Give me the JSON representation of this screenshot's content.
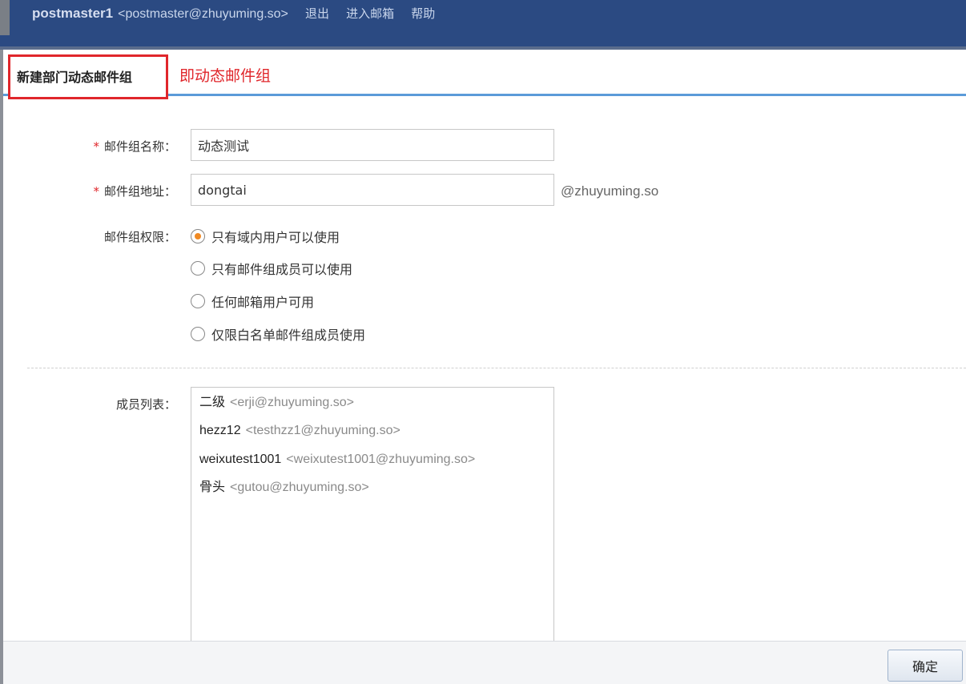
{
  "header": {
    "username": "postmaster1",
    "email": "<postmaster@zhuyuming.so>",
    "links": [
      "退出",
      "进入邮箱",
      "帮助"
    ]
  },
  "tabs": {
    "active_label": "新建部门动态邮件组",
    "annotation": "即动态邮件组"
  },
  "form": {
    "name_label": "邮件组名称：",
    "name_value": "动态测试",
    "address_label": "邮件组地址：",
    "address_value": "dongtai",
    "address_suffix": "@zhuyuming.so",
    "required_mark": "*",
    "permission_label": "邮件组权限：",
    "permission_options": [
      {
        "label": "只有域内用户可以使用",
        "selected": true
      },
      {
        "label": "只有邮件组成员可以使用",
        "selected": false
      },
      {
        "label": "任何邮箱用户可用",
        "selected": false
      },
      {
        "label": "仅限白名单邮件组成员使用",
        "selected": false
      }
    ],
    "members_label": "成员列表：",
    "members": [
      {
        "name": "二级",
        "email": "<erji@zhuyuming.so>"
      },
      {
        "name": "hezz12",
        "email": "<testhzz1@zhuyuming.so>"
      },
      {
        "name": "weixutest1001",
        "email": "<weixutest1001@zhuyuming.so>"
      },
      {
        "name": "骨头",
        "email": "<gutou@zhuyuming.so>"
      }
    ]
  },
  "footer": {
    "confirm_label": "确定"
  },
  "colors": {
    "header_bg": "#2b4a82",
    "highlight_red": "#e0262b",
    "tab_underline": "#5b9bd9",
    "radio_selected": "#f08a24"
  }
}
